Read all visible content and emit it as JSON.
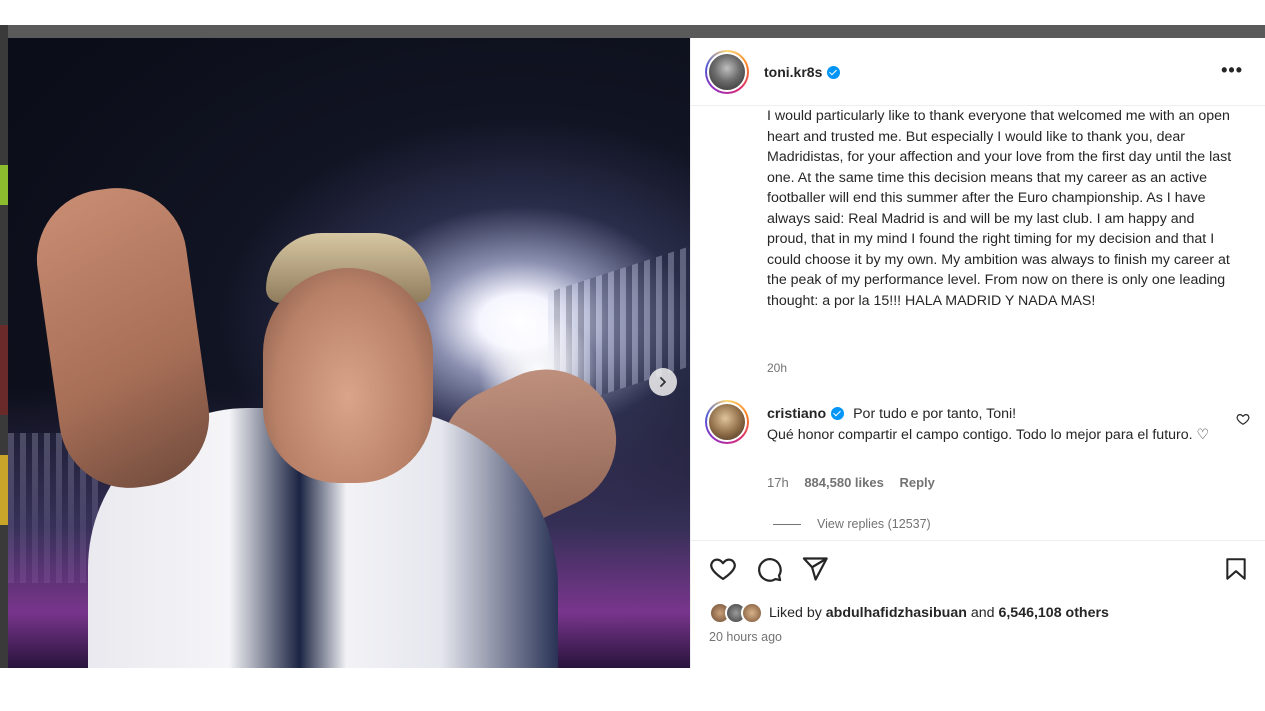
{
  "post": {
    "username": "toni.kr8s",
    "caption": "I would particularly like to thank everyone that welcomed me with an open heart and trusted me. But especially I would like to thank you, dear Madridistas, for your affection and your love from the first day until the last one. At the same time this decision means that my career as an active footballer will end this summer after the Euro championship. As I have always said: Real Madrid is and will be my last club. I am happy and proud, that in my mind I found the right timing for my decision and that I could choose it by my own. My ambition was always to finish my career at the peak of my performance level. From now on there is only one leading thought: a por la 15!!! HALA MADRID Y NADA MAS!",
    "caption_time": "20h",
    "more_label": "•••"
  },
  "comment": {
    "username": "cristiano",
    "text": "Por tudo e por tanto, Toni!\nQué honor compartir el campo contigo. Todo lo mejor para el futuro. ♡",
    "time": "17h",
    "likes": "884,580 likes",
    "reply_label": "Reply",
    "view_replies": "View replies (12537)"
  },
  "likes": {
    "prefix": "Liked by",
    "user": "abdulhafidzhasibuan",
    "middle": "and",
    "others": "6,546,108 others"
  },
  "posted_time": "20 hours ago",
  "icons": {
    "next": "chevron-right-icon",
    "like": "heart-icon",
    "comment": "comment-icon",
    "share": "send-icon",
    "save": "bookmark-icon"
  },
  "colors": {
    "verified": "#0095f6",
    "text": "#262626",
    "muted": "#737373"
  }
}
